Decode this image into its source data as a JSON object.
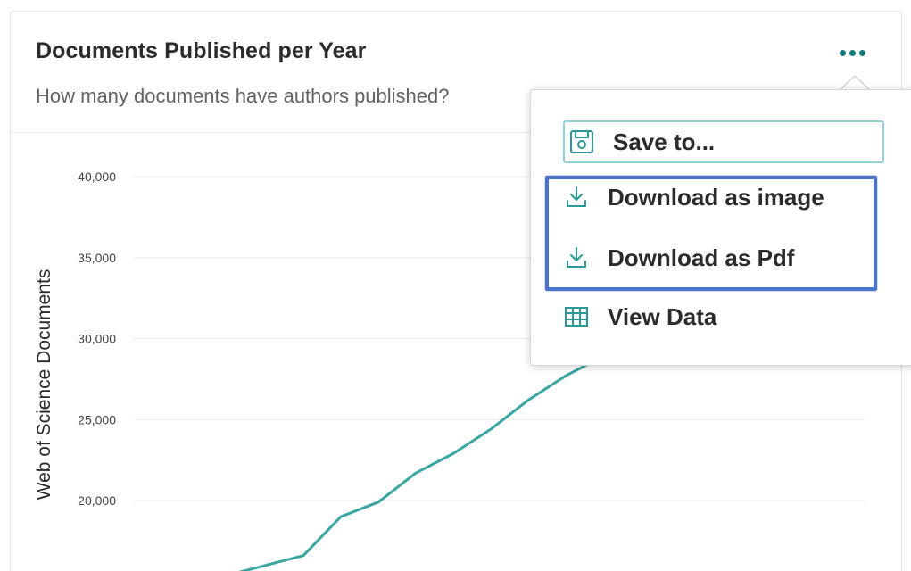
{
  "card": {
    "title": "Documents Published per Year",
    "subtitle": "How many documents have authors published?"
  },
  "icons": {
    "more": "more-horizontal-icon",
    "save": "save-to-icon",
    "download": "download-icon",
    "table": "table-grid-icon"
  },
  "colors": {
    "accent": "#3aa6a0",
    "more_dots": "#117a7a",
    "highlight": "#4a74c9",
    "gridline": "#ececec"
  },
  "menu": {
    "items": [
      {
        "label": "Save to...",
        "icon": "save-to-icon"
      },
      {
        "label": "Download as image",
        "icon": "download-icon"
      },
      {
        "label": "Download as Pdf",
        "icon": "download-icon"
      },
      {
        "label": "View Data",
        "icon": "table-grid-icon"
      }
    ]
  },
  "chart_data": {
    "type": "line",
    "title": "Documents Published per Year",
    "subtitle": "How many documents have authors published?",
    "xlabel": "",
    "ylabel": "Web of Science Documents",
    "ylim": [
      15000,
      42000
    ],
    "y_ticks": [
      {
        "value": 40000,
        "label": "40,000"
      },
      {
        "value": 35000,
        "label": "35,000"
      },
      {
        "value": 30000,
        "label": "30,000"
      },
      {
        "value": 25000,
        "label": "25,000"
      },
      {
        "value": 20000,
        "label": "20,000"
      }
    ],
    "grid": true,
    "series": [
      {
        "values": [
          15000,
          15300,
          15400,
          16000,
          16600,
          19000,
          19900,
          21700,
          22900,
          24400,
          26200,
          27700,
          28900
        ]
      }
    ]
  }
}
